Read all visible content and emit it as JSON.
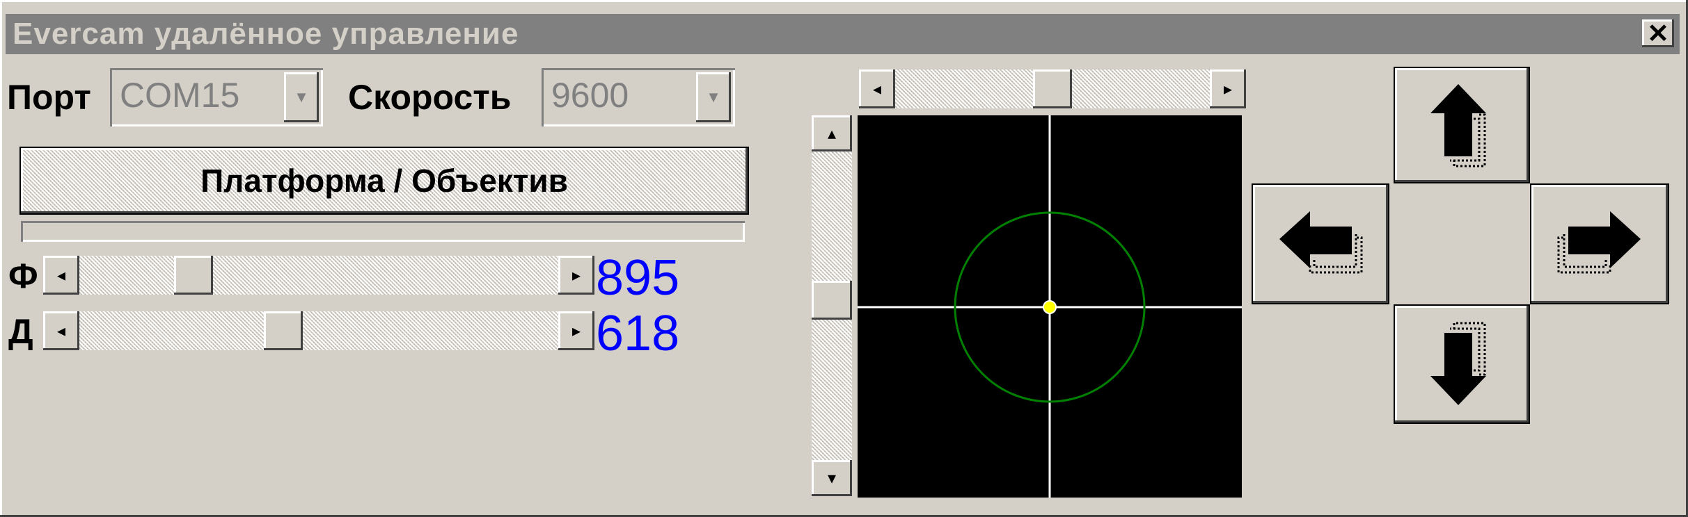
{
  "window": {
    "title": "Evercam удалённое управление",
    "close_glyph": "✕"
  },
  "port": {
    "label": "Порт",
    "value": "COM15"
  },
  "speed": {
    "label": "Скорость",
    "value": "9600"
  },
  "mode_button": {
    "label": "Платформа / Объектив"
  },
  "sliders": {
    "focus": {
      "label": "Ф",
      "value": "895",
      "fraction": 0.215
    },
    "zoom": {
      "label": "Д",
      "value": "618",
      "fraction": 0.42
    }
  },
  "view": {
    "h_position": 0.5,
    "v_position": 0.48,
    "crosshair_color": "#ffffff",
    "circle_color": "#008000",
    "center_color": "#ffff00"
  },
  "icons": {
    "scroll_left": "◂",
    "scroll_right": "▸",
    "scroll_up": "▴",
    "scroll_down": "▾",
    "dropdown": "▼"
  },
  "colors": {
    "face": "#d4d0c8",
    "title_bar": "#808080",
    "value_text": "#0000ff"
  }
}
